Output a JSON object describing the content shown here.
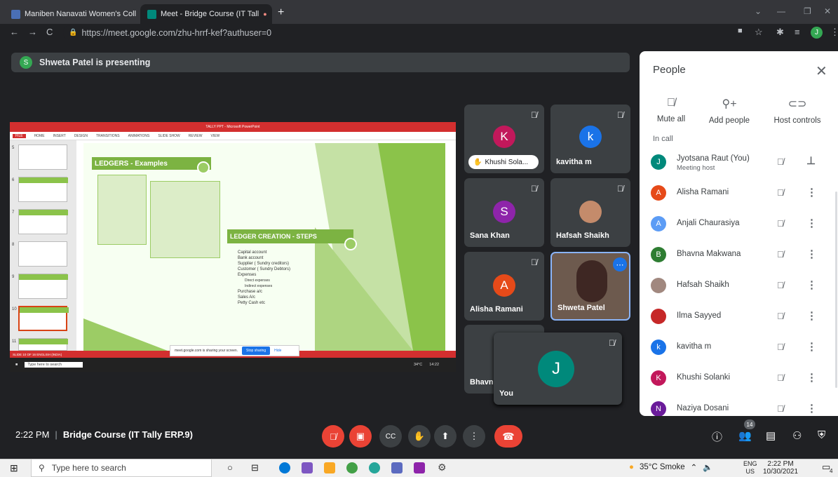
{
  "browser": {
    "tabs": [
      {
        "label": "Maniben Nanavati Women's Coll",
        "active": false,
        "fav_color": "#4a6fb5"
      },
      {
        "label": "Meet - Bridge Course (IT Tall",
        "active": true,
        "fav_color": "#00897b"
      }
    ],
    "url": "https://meet.google.com/zhu-hrrf-kef?authuser=0",
    "profile_initial": "J"
  },
  "meet": {
    "presenting_initial": "S",
    "presenting": "Shweta Patel is presenting",
    "meeting_time": "2:22 PM",
    "separator": "|",
    "meeting_title": "Bridge Course (IT Tally ERP.9)",
    "participant_count": "14"
  },
  "presentation": {
    "app_title": "TALLY PPT - Microsoft PowerPoint",
    "ribbon": [
      "FILE",
      "HOME",
      "INSERT",
      "DESIGN",
      "TRANSITIONS",
      "ANIMATIONS",
      "SLIDE SHOW",
      "REVIEW",
      "VIEW"
    ],
    "slide_numbers": [
      "5",
      "6",
      "7",
      "8",
      "9",
      "10",
      "11"
    ],
    "title1": "LEDGERS - Examples",
    "title2": "LEDGER CREATION  - STEPS",
    "steps": [
      "Capital account",
      "Bank account",
      "Supplier ( Sundry creditors)",
      "Customer ( Sundry Debtors)",
      "Expenses",
      "Direct expenses",
      "Indirect expenses",
      "Purchase a/c",
      "Sales A/c",
      "Petty Cash  etc"
    ],
    "status": "SLIDE 10 OF 16    ENGLISH (INDIA)",
    "share_text": "meet.google.com is sharing your screen.",
    "stop_sharing": "Stop sharing",
    "hide": "Hide",
    "inner_search": "Type here to search",
    "inner_tray": "34°C",
    "inner_clock": "14:22"
  },
  "tiles": [
    {
      "name": "Khushi Sola...",
      "initial": "K",
      "color": "#c2185b",
      "pill": true
    },
    {
      "name": "kavitha m",
      "initial": "k",
      "color": "#1a73e8"
    },
    {
      "name": "Sana Khan",
      "initial": "S",
      "color": "#8e24aa"
    },
    {
      "name": "Hafsah Shaikh",
      "initial": "",
      "color": "#c48b6b",
      "photo": true
    },
    {
      "name": "Alisha Ramani",
      "initial": "A",
      "color": "#e64a19"
    },
    {
      "name": "Shweta Patel",
      "initial": "",
      "color": "#5d4037",
      "photo": true
    },
    {
      "name": "Bhavn",
      "initial": "",
      "color": "#3c4043"
    },
    {
      "name": "You",
      "initial": "J",
      "color": "#00897b"
    }
  ],
  "people": {
    "title": "People",
    "actions": [
      {
        "label": "Mute all",
        "icon": "mic-off-icon"
      },
      {
        "label": "Add people",
        "icon": "person-add-icon"
      },
      {
        "label": "Host controls",
        "icon": "toggle-icon"
      }
    ],
    "in_call": "In call",
    "list": [
      {
        "name": "Jyotsana Raut (You)",
        "sub": "Meeting host",
        "initial": "J",
        "color": "#00897b"
      },
      {
        "name": "Alisha Ramani",
        "initial": "A",
        "color": "#e64a19"
      },
      {
        "name": "Anjali Chaurasiya",
        "initial": "A",
        "color": "#5c9cf5"
      },
      {
        "name": "Bhavna Makwana",
        "initial": "B",
        "color": "#2e7d32"
      },
      {
        "name": "Hafsah Shaikh",
        "initial": "",
        "color": "#a1887f"
      },
      {
        "name": "Ilma Sayyed",
        "initial": "",
        "color": "#c62828"
      },
      {
        "name": "kavitha m",
        "initial": "k",
        "color": "#1a73e8"
      },
      {
        "name": "Khushi Solanki",
        "initial": "K",
        "color": "#c2185b"
      },
      {
        "name": "Naziya Dosani",
        "initial": "N",
        "color": "#6a1b9a"
      }
    ]
  },
  "taskbar": {
    "search": "Type here to search",
    "weather": "35°C  Smoke",
    "lang1": "ENG",
    "lang2": "US",
    "time": "2:22 PM",
    "date": "10/30/2021",
    "notif_count": "4"
  }
}
